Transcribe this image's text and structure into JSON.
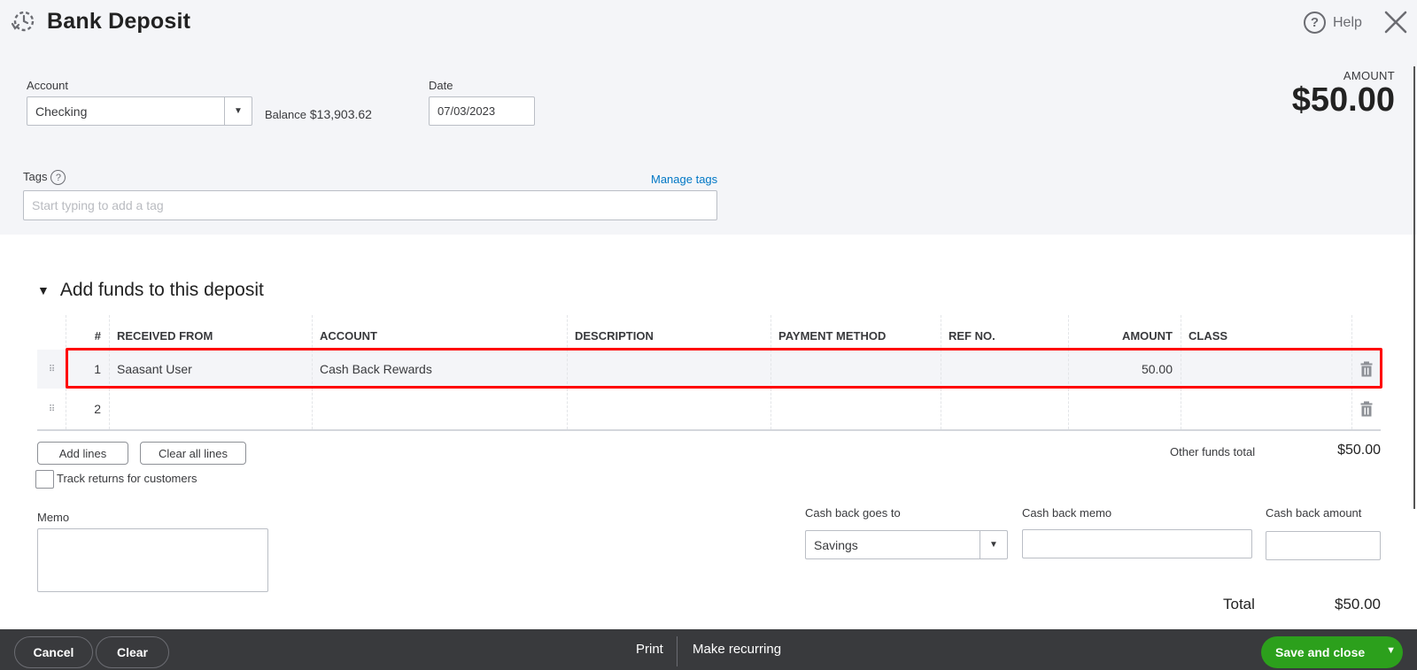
{
  "header": {
    "title": "Bank Deposit",
    "icon": "recent-transactions-icon",
    "help_label": "Help",
    "help_icon": "?",
    "close_icon": "close-icon"
  },
  "summary": {
    "amount_label": "AMOUNT",
    "amount_value": "$50.00"
  },
  "account": {
    "label": "Account",
    "value": "Checking",
    "balance_label": "Balance",
    "balance_value": "$13,903.62"
  },
  "date": {
    "label": "Date",
    "value": "07/03/2023"
  },
  "tags": {
    "label": "Tags",
    "help_icon": "?",
    "manage_label": "Manage tags",
    "placeholder": "Start typing to add a tag"
  },
  "funds": {
    "section_title": "Add funds to this deposit",
    "collapse_icon": "▼",
    "columns": [
      "#",
      "RECEIVED FROM",
      "ACCOUNT",
      "DESCRIPTION",
      "PAYMENT METHOD",
      "REF NO.",
      "AMOUNT",
      "CLASS"
    ],
    "rows": [
      {
        "num": "1",
        "received_from": "Saasant User",
        "account": "Cash Back Rewards",
        "description": "",
        "payment_method": "",
        "ref_no": "",
        "amount": "50.00",
        "class": ""
      },
      {
        "num": "2",
        "received_from": "",
        "account": "",
        "description": "",
        "payment_method": "",
        "ref_no": "",
        "amount": "",
        "class": ""
      }
    ],
    "add_lines_label": "Add lines",
    "clear_all_lines_label": "Clear all lines",
    "track_returns_label": "Track returns for customers",
    "track_returns_checked": false,
    "other_funds_total_label": "Other funds total",
    "other_funds_total_value": "$50.00"
  },
  "memo": {
    "label": "Memo",
    "value": ""
  },
  "cashback": {
    "goes_to_label": "Cash back goes to",
    "goes_to_value": "Savings",
    "memo_label": "Cash back memo",
    "memo_value": "",
    "amount_label": "Cash back amount",
    "amount_value": ""
  },
  "totals": {
    "total_label": "Total",
    "total_value": "$50.00"
  },
  "footer": {
    "cancel_label": "Cancel",
    "clear_label": "Clear",
    "print_label": "Print",
    "recurring_label": "Make recurring",
    "save_label": "Save and close",
    "save_color": "#2ca01c"
  },
  "colors": {
    "highlight": "#ff0000",
    "link": "#0077c5",
    "footer_bg": "#393a3d"
  }
}
